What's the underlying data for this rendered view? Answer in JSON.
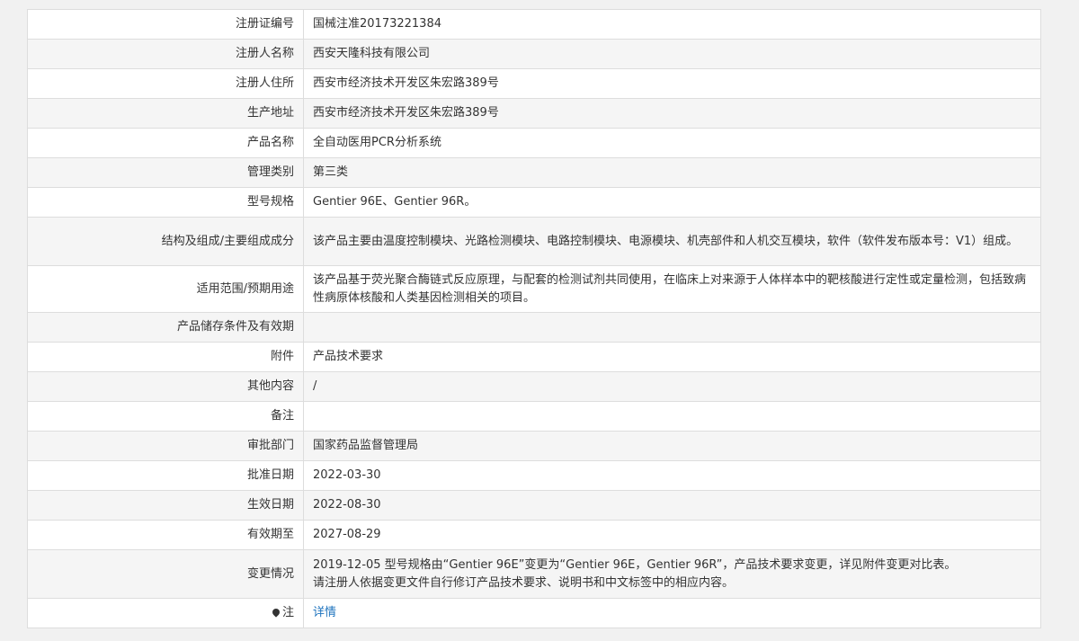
{
  "rows": [
    {
      "label": "注册证编号",
      "value": "国械注准20173221384"
    },
    {
      "label": "注册人名称",
      "value": "西安天隆科技有限公司"
    },
    {
      "label": "注册人住所",
      "value": "西安市经济技术开发区朱宏路389号"
    },
    {
      "label": "生产地址",
      "value": "西安市经济技术开发区朱宏路389号"
    },
    {
      "label": "产品名称",
      "value": "全自动医用PCR分析系统"
    },
    {
      "label": "管理类别",
      "value": "第三类"
    },
    {
      "label": "型号规格",
      "value": "Gentier 96E、Gentier 96R。"
    },
    {
      "label": "结构及组成/主要组成成分",
      "value": "该产品主要由温度控制模块、光路检测模块、电路控制模块、电源模块、机壳部件和人机交互模块，软件（软件发布版本号：V1）组成。"
    },
    {
      "label": "适用范围/预期用途",
      "value": "该产品基于荧光聚合酶链式反应原理，与配套的检测试剂共同使用，在临床上对来源于人体样本中的靶核酸进行定性或定量检测，包括致病性病原体核酸和人类基因检测相关的项目。"
    },
    {
      "label": "产品储存条件及有效期",
      "value": ""
    },
    {
      "label": "附件",
      "value": "产品技术要求"
    },
    {
      "label": "其他内容",
      "value": "/"
    },
    {
      "label": "备注",
      "value": ""
    },
    {
      "label": "审批部门",
      "value": "国家药品监督管理局"
    },
    {
      "label": "批准日期",
      "value": "2022-03-30"
    },
    {
      "label": "生效日期",
      "value": "2022-08-30"
    },
    {
      "label": "有效期至",
      "value": "2027-08-29"
    },
    {
      "label": "变更情况",
      "value_line1": "2019-12-05 型号规格由“Gentier 96E”变更为“Gentier 96E，Gentier 96R”，产品技术要求变更，详见附件变更对比表。",
      "value_line2": "请注册人依据变更文件自行修订产品技术要求、说明书和中文标签中的相应内容。"
    },
    {
      "label": "注",
      "value": "详情"
    }
  ],
  "icons": {
    "note_icon": "map-pin-icon"
  },
  "colors": {
    "link": "#1e73be",
    "border": "#dddddd",
    "row_alt": "#f5f5f5"
  }
}
